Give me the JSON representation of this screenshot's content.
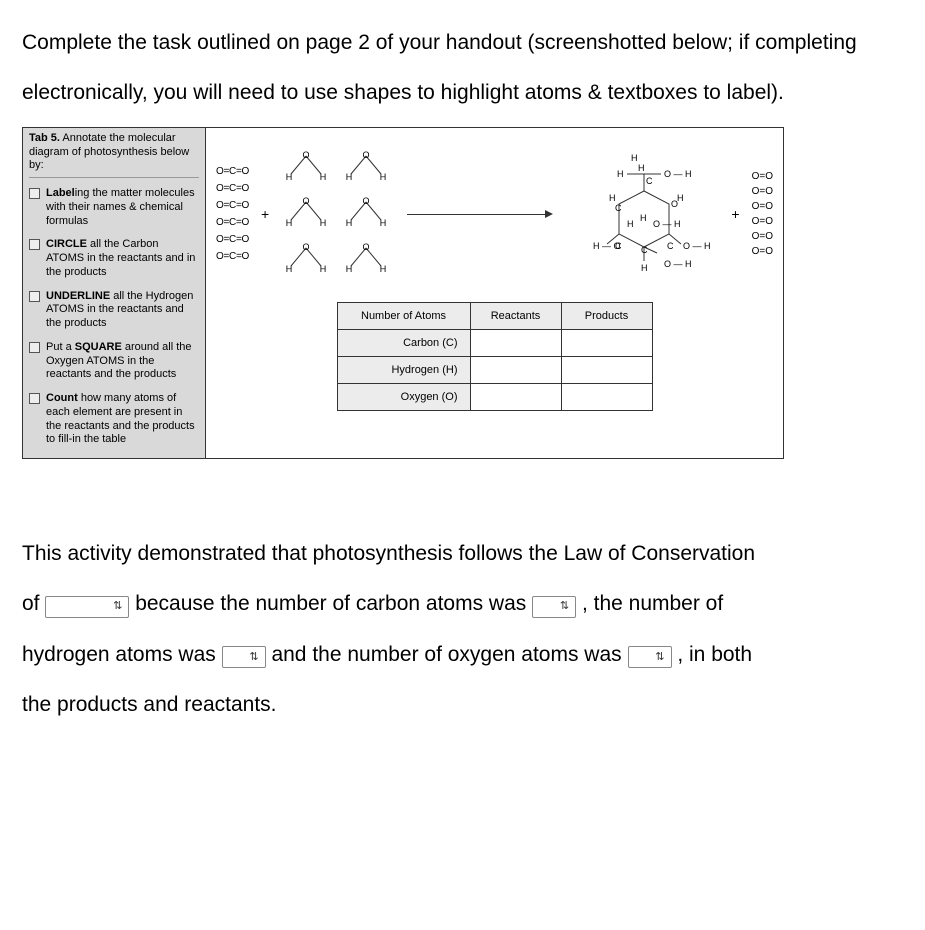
{
  "intro_text": "Complete the task outlined on page 2 of your handout (screenshotted below; if completing electronically, you will need to use shapes to highlight atoms & textboxes to label).",
  "handout": {
    "title_prefix": "Tab 5.",
    "title_body": "  Annotate the molecular diagram of photosynthesis below by:",
    "tasks": [
      "Labeling the matter molecules with their names & chemical formulas",
      "CIRCLE all the Carbon ATOMS in the reactants and in the products",
      "UNDERLINE all the Hydrogen ATOMS in the reactants and the products",
      "Put a SQUARE around all the Oxygen ATOMS in the reactants and the products",
      "Count how many atoms of each element are present in the reactants and the products to fill-in the table"
    ],
    "tasks_bold": [
      "Label",
      "CIRCLE",
      "UNDERLINE",
      "SQUARE",
      "Count"
    ],
    "co2_formula": "O=C=O",
    "co2_count": 6,
    "plus_sign": "+",
    "water_H": "H",
    "water_O": "O",
    "o2_formula": "O=O",
    "o2_count": 6,
    "table": {
      "headers": [
        "Number of Atoms",
        "Reactants",
        "Products"
      ],
      "rows": [
        "Carbon (C)",
        "Hydrogen (H)",
        "Oxygen (O)"
      ]
    }
  },
  "fill": {
    "p1": "This activity demonstrated that photosynthesis follows the Law of Conservation",
    "p2a": "of ",
    "p2b": " because the number of carbon atoms was ",
    "p2c": " , the number of",
    "p3a": "hydrogen atoms was ",
    "p3b": " and the number of oxygen atoms was ",
    "p3c": ", in both",
    "p4": "the products and reactants."
  }
}
